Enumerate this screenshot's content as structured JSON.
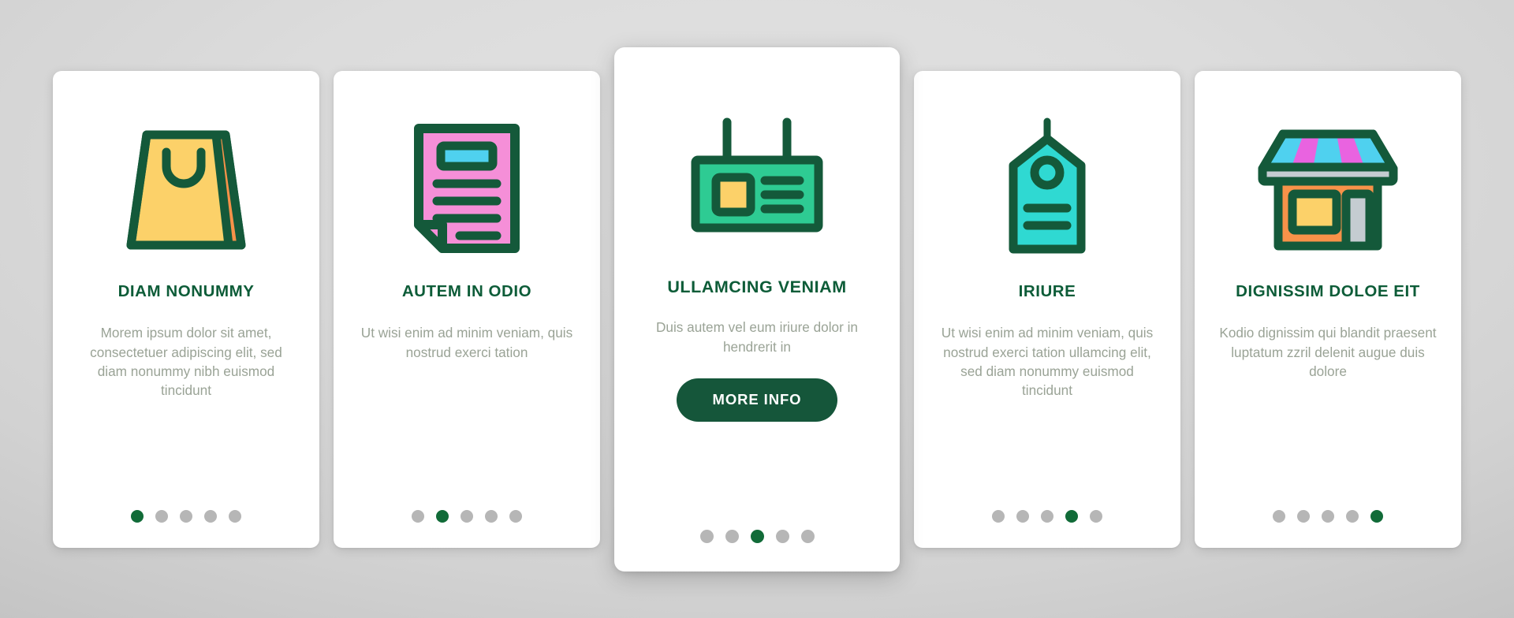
{
  "theme": {
    "background": "#d4d4d4",
    "card_background": "#ffffff",
    "title_color": "#0d5c38",
    "body_color": "#9aa396",
    "dot_inactive": "#b6b6b6",
    "dot_active": "#116b38",
    "button_background": "#15563a",
    "button_text_color": "#ffffff",
    "icon_outline": "#14593a"
  },
  "cards": [
    {
      "icon": "shopping-bag-icon",
      "icon_colors": {
        "body": "#fcd169",
        "side_panel": "#f79249",
        "outline": "#14593a"
      },
      "title": "DIAM NONUMMY",
      "body": "Morem ipsum dolor sit amet, consectetuer adipiscing elit, sed diam nonummy nibh euismod tincidunt",
      "dots": {
        "count": 5,
        "active_index": 0
      },
      "featured": false,
      "button": null
    },
    {
      "icon": "document-icon",
      "icon_colors": {
        "page": "#f58fd8",
        "header_block": "#4fd1ef",
        "outline": "#14593a"
      },
      "title": "AUTEM IN ODIO",
      "body": "Ut wisi enim ad minim veniam, quis nostrud exerci tation",
      "dots": {
        "count": 5,
        "active_index": 1
      },
      "featured": false,
      "button": null
    },
    {
      "icon": "billboard-sign-icon",
      "icon_colors": {
        "panel": "#2ecb93",
        "square": "#fcd169",
        "outline": "#14593a"
      },
      "title": "ULLAMCING VENIAM",
      "body": "Duis autem vel eum iriure dolor in hendrerit in",
      "dots": {
        "count": 5,
        "active_index": 2
      },
      "featured": true,
      "button": {
        "label": "MORE INFO"
      }
    },
    {
      "icon": "price-tag-icon",
      "icon_colors": {
        "tag": "#2fd9d2",
        "outline": "#14593a"
      },
      "title": "IRIURE",
      "body": "Ut wisi enim ad minim veniam, quis nostrud exerci tation ullamcing elit, sed diam nonummy euismod tincidunt",
      "dots": {
        "count": 5,
        "active_index": 3
      },
      "featured": false,
      "button": null
    },
    {
      "icon": "storefront-icon",
      "icon_colors": {
        "wall": "#f79249",
        "window": "#fcd169",
        "door": "#c4ccd1",
        "awning_a": "#4fd1ef",
        "awning_b": "#e963e0",
        "awning_base": "#c4ccd1",
        "outline": "#14593a"
      },
      "title": "DIGNISSIM DOLOE EIT",
      "body": "Kodio dignissim qui blandit praesent luptatum zzril delenit augue duis dolore",
      "dots": {
        "count": 5,
        "active_index": 4
      },
      "featured": false,
      "button": null
    }
  ]
}
